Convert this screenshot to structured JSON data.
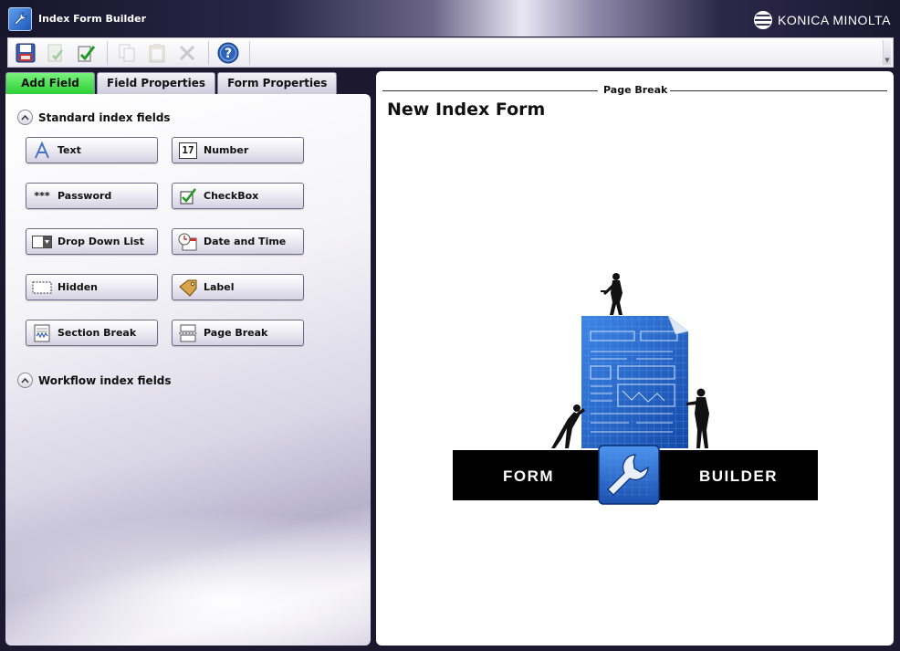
{
  "window": {
    "title": "Index Form Builder",
    "brand": "KONICA MINOLTA"
  },
  "toolbar": {
    "buttons": [
      {
        "icon": "save-icon",
        "enabled": true
      },
      {
        "icon": "save-as-icon",
        "enabled": false
      },
      {
        "icon": "validate-icon",
        "enabled": true
      },
      {
        "icon": "copy-icon",
        "enabled": false
      },
      {
        "icon": "paste-icon",
        "enabled": false
      },
      {
        "icon": "delete-icon",
        "enabled": false
      },
      {
        "icon": "help-icon",
        "enabled": true
      }
    ]
  },
  "tabs": [
    {
      "label": "Add Field",
      "active": true
    },
    {
      "label": "Field Properties",
      "active": false
    },
    {
      "label": "Form Properties",
      "active": false
    }
  ],
  "sections": {
    "standard": "Standard index fields",
    "workflow": "Workflow index fields"
  },
  "fields": [
    {
      "label": "Text",
      "icon": "text-icon"
    },
    {
      "label": "Number",
      "icon": "number-icon"
    },
    {
      "label": "Password",
      "icon": "password-icon"
    },
    {
      "label": "CheckBox",
      "icon": "checkbox-icon"
    },
    {
      "label": "Drop Down List",
      "icon": "dropdown-icon"
    },
    {
      "label": "Date and Time",
      "icon": "calendar-icon"
    },
    {
      "label": "Hidden",
      "icon": "hidden-icon"
    },
    {
      "label": "Label",
      "icon": "tag-icon"
    },
    {
      "label": "Section Break",
      "icon": "section-break-icon"
    },
    {
      "label": "Page Break",
      "icon": "page-break-icon"
    }
  ],
  "icon_text": {
    "number": "17",
    "password": "***"
  },
  "canvas": {
    "page_break_label": "Page Break",
    "form_title": "New Index Form",
    "logo_left": "FORM",
    "logo_right": "BUILDER"
  },
  "colors": {
    "active_tab": "#2bd135",
    "blueprint": "#1f63c9",
    "logo_bar": "#000000"
  }
}
